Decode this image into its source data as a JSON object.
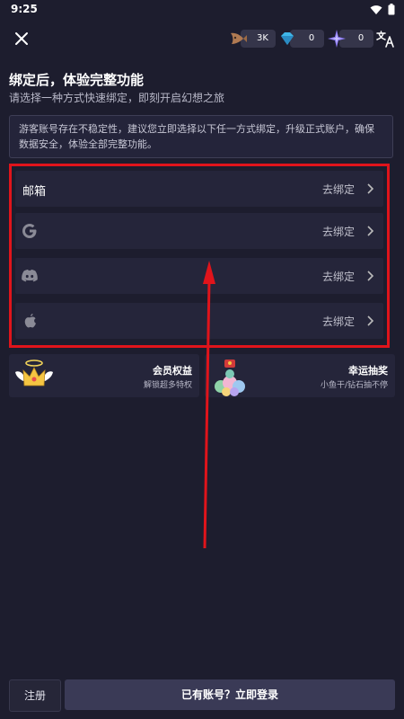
{
  "status_bar": {
    "time": "9:25"
  },
  "header": {
    "currencies": [
      {
        "icon": "fish-icon",
        "value": "3K"
      },
      {
        "icon": "diamond-icon",
        "value": "0"
      },
      {
        "icon": "star-icon",
        "value": "0"
      }
    ]
  },
  "main": {
    "title": "绑定后，体验完整功能",
    "subtitle": "请选择一种方式快速绑定，即刻开启幻想之旅",
    "notice": "游客账号存在不稳定性，建议您立即选择以下任一方式绑定，升级正式账户，确保数据安全，体验全部完整功能。",
    "bind_options": [
      {
        "label": "邮箱",
        "action": "去绑定"
      },
      {
        "icon": "google-icon",
        "action": "去绑定"
      },
      {
        "icon": "discord-icon",
        "action": "去绑定"
      },
      {
        "icon": "apple-icon",
        "action": "去绑定"
      }
    ],
    "cards": [
      {
        "title": "会员权益",
        "subtitle": "解锁超多特权",
        "icon": "crown-icon"
      },
      {
        "title": "幸运抽奖",
        "subtitle": "小鱼干/钻石抽不停",
        "icon": "gift-icon"
      }
    ]
  },
  "footer": {
    "register_label": "注册",
    "login_label": "已有账号？立即登录"
  },
  "colors": {
    "background": "#1d1d2e",
    "highlight": "#e0141b"
  }
}
